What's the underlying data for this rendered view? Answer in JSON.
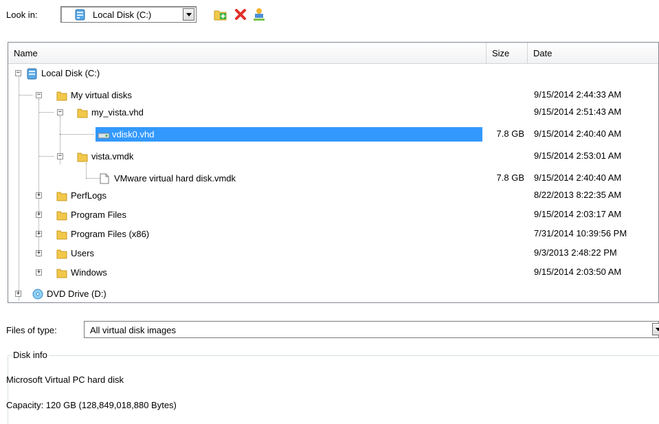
{
  "look_in": {
    "label": "Look in:",
    "value": "Local Disk (C:)",
    "toolbar_icons": [
      "new-folder-icon",
      "delete-icon",
      "network-icon"
    ]
  },
  "columns": {
    "name": "Name",
    "size": "Size",
    "date": "Date"
  },
  "tree": [
    {
      "label": "Local Disk (C:)",
      "size": "",
      "date": "",
      "icon": "drive-icon",
      "expanded": true
    },
    {
      "label": "My virtual disks",
      "size": "",
      "date": "9/15/2014 2:44:33 AM",
      "icon": "folder-icon",
      "expanded": true
    },
    {
      "label": "my_vista.vhd",
      "size": "",
      "date": "9/15/2014 2:51:43 AM",
      "icon": "folder-icon",
      "expanded": true
    },
    {
      "label": "vdisk0.vhd",
      "size": "7.8 GB",
      "date": "9/15/2014 2:40:40 AM",
      "icon": "virtual-disk-icon",
      "selected": true
    },
    {
      "label": "vista.vmdk",
      "size": "",
      "date": "9/15/2014 2:53:01 AM",
      "icon": "folder-icon",
      "expanded": true
    },
    {
      "label": "VMware virtual hard disk.vmdk",
      "size": "7.8 GB",
      "date": "9/15/2014 2:40:40 AM",
      "icon": "file-icon"
    },
    {
      "label": "PerfLogs",
      "size": "",
      "date": "8/22/2013 8:22:35 AM",
      "icon": "folder-icon",
      "expanded": false
    },
    {
      "label": "Program Files",
      "size": "",
      "date": "9/15/2014 2:03:17 AM",
      "icon": "folder-icon",
      "expanded": false
    },
    {
      "label": "Program Files (x86)",
      "size": "",
      "date": "7/31/2014 10:39:56 PM",
      "icon": "folder-icon",
      "expanded": false
    },
    {
      "label": "Users",
      "size": "",
      "date": "9/3/2013 2:48:22 PM",
      "icon": "folder-icon",
      "expanded": false
    },
    {
      "label": "Windows",
      "size": "",
      "date": "9/15/2014 2:03:50 AM",
      "icon": "folder-icon",
      "expanded": false
    },
    {
      "label": "DVD Drive (D:)",
      "size": "",
      "date": "",
      "icon": "dvd-icon",
      "expanded": false
    }
  ],
  "files_of_type": {
    "label": "Files of type:",
    "value": "All virtual disk images"
  },
  "disk_info": {
    "legend": "Disk info",
    "description": "Microsoft Virtual PC hard disk",
    "capacity": "Capacity:  120 GB (128,849,018,880 Bytes)"
  },
  "colors": {
    "selection": "#3399ff",
    "folder": "#f2c84b",
    "drive": "#4a90d9"
  }
}
